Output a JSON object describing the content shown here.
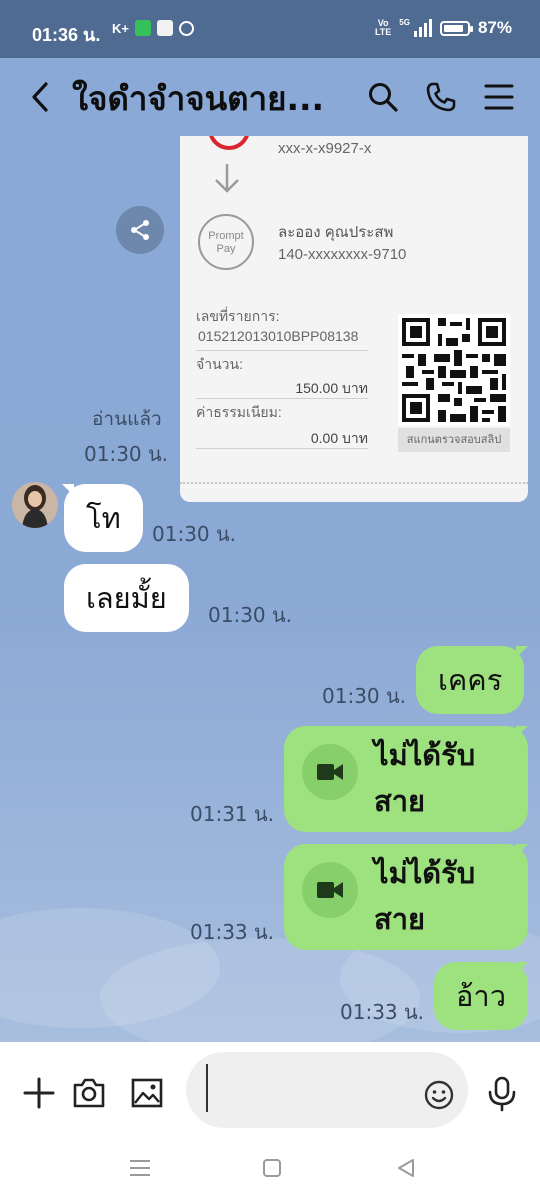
{
  "status_bar": {
    "time": "01:36 น.",
    "kplus": "K+",
    "volte_top": "Vo",
    "volte_bottom": "LTE",
    "network": "5G",
    "battery": "87%"
  },
  "header": {
    "title": "ใจดำจำจนตาย...",
    "icons": [
      "chevron-left-icon",
      "search-icon",
      "phone-icon",
      "menu-icon"
    ]
  },
  "slip": {
    "account_from": "xxx-x-x9927-x",
    "logo_text_1": "Prompt",
    "logo_text_2": "Pay",
    "recipient_name": "ละออง คุณประสพ",
    "recipient_account": "140-xxxxxxxx-9710",
    "ref_label": "เลขที่รายการ:",
    "ref_value": "015212013010BPP08138",
    "amount_label": "จำนวน:",
    "amount_value": "150.00 บาท",
    "fee_label": "ค่าธรรมเนียม:",
    "fee_value": "0.00 บาท",
    "qr_caption": "สแกนตรวจสอบสลิป"
  },
  "messages": {
    "slip_read": "อ่านแล้ว",
    "slip_time": "01:30 น.",
    "m1_text": "โท",
    "m1_time": "01:30 น.",
    "m2_text": "เลยมั้ย",
    "m2_time": "01:30 น.",
    "m3_text": "เคคร",
    "m3_time": "01:30 น.",
    "m4_text": "ไม่ได้รับสาย",
    "m4_time": "01:31 น.",
    "m5_text": "ไม่ได้รับสาย",
    "m5_time": "01:33 น.",
    "m6_text": "อ้าว",
    "m6_time": "01:33 น."
  },
  "input": {
    "value": "",
    "placeholder": ""
  },
  "colors": {
    "status_bar": "#4f6b92",
    "chat_background": "#8aa9d6",
    "outgoing_bubble": "#9de27f",
    "incoming_bubble": "#ffffff"
  }
}
